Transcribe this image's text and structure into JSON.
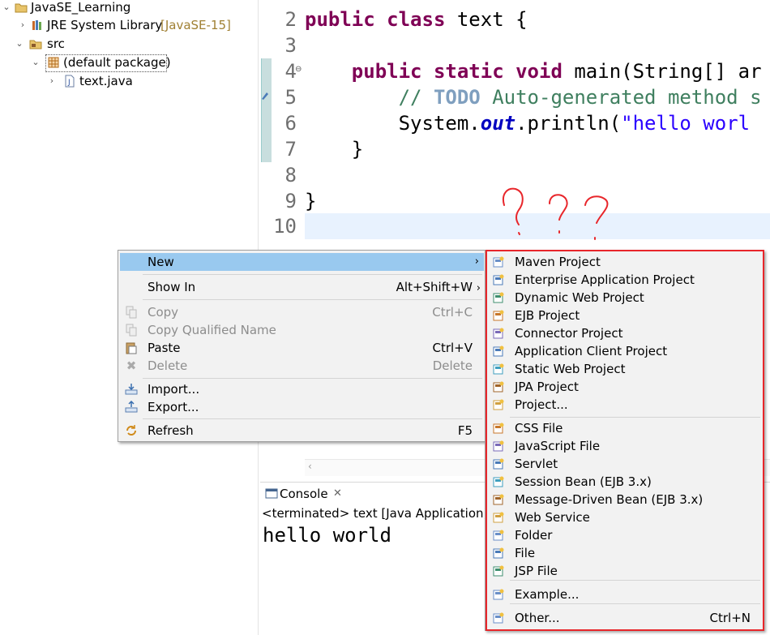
{
  "explorer": {
    "project": "JavaSE_Learning",
    "jre_label": "JRE System Library",
    "jre_decoration": "[JavaSE-15]",
    "src": "src",
    "package": "(default package)",
    "file": "text.java"
  },
  "editor": {
    "line_numbers": [
      "2",
      "3",
      "4",
      "5",
      "6",
      "7",
      "8",
      "9",
      "10"
    ],
    "code": {
      "l2_kw1": "public",
      "l2_kw2": "class",
      "l2_rest": " text {",
      "l4_kw1": "public",
      "l4_kw2": "static",
      "l4_kw3": "void",
      "l4_rest": " main(String[] ar",
      "l5_pre": "// ",
      "l5_todo": "TODO",
      "l5_rest": " Auto-generated method s",
      "l6_pre": "System.",
      "l6_field": "out",
      "l6_mid": ".println(",
      "l6_str": "\"hello worl",
      "l7": "}",
      "l9": "}"
    }
  },
  "console": {
    "tab_label": "Console",
    "status": "<terminated> text [Java Application] [",
    "output": "hello world"
  },
  "context_menu": {
    "new": "New",
    "show_in": "Show In",
    "show_in_accel": "Alt+Shift+W",
    "copy": "Copy",
    "copy_accel": "Ctrl+C",
    "copy_qualified": "Copy Qualified Name",
    "paste": "Paste",
    "paste_accel": "Ctrl+V",
    "delete": "Delete",
    "delete_accel": "Delete",
    "import": "Import...",
    "export": "Export...",
    "refresh": "Refresh",
    "refresh_accel": "F5"
  },
  "new_submenu": {
    "items": [
      "Maven Project",
      "Enterprise Application Project",
      "Dynamic Web Project",
      "EJB Project",
      "Connector Project",
      "Application Client Project",
      "Static Web Project",
      "JPA Project",
      "Project..."
    ],
    "items2": [
      "CSS File",
      "JavaScript File",
      "Servlet",
      "Session Bean (EJB 3.x)",
      "Message-Driven Bean (EJB 3.x)",
      "Web Service",
      "Folder",
      "File",
      "JSP File"
    ],
    "example": "Example...",
    "other": "Other...",
    "other_accel": "Ctrl+N"
  },
  "colors": {
    "highlight": "#99c9ef",
    "annotation_red": "#e8262b",
    "keyword": "#7f0055",
    "comment": "#3f7f5f",
    "string": "#2a00ff"
  }
}
